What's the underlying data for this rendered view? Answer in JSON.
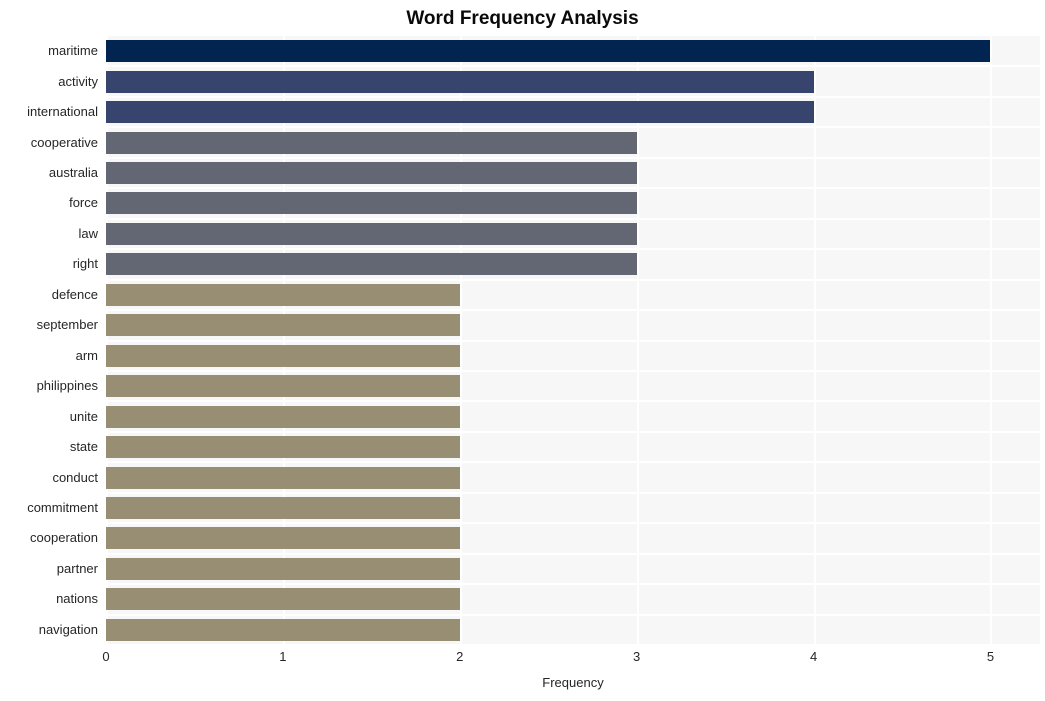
{
  "chart_data": {
    "type": "bar",
    "orientation": "horizontal",
    "title": "Word Frequency Analysis",
    "xlabel": "Frequency",
    "ylabel": "",
    "xlim": [
      0,
      5.28
    ],
    "xticks": [
      0,
      1,
      2,
      3,
      4,
      5
    ],
    "xtick_labels": [
      "0",
      "1",
      "2",
      "3",
      "4",
      "5"
    ],
    "grid": true,
    "grid_color": "#ffffff",
    "plot_background": "#f7f7f7",
    "legend": null,
    "categories": [
      "maritime",
      "activity",
      "international",
      "cooperative",
      "australia",
      "force",
      "law",
      "right",
      "defence",
      "september",
      "arm",
      "philippines",
      "unite",
      "state",
      "conduct",
      "commitment",
      "cooperation",
      "partner",
      "nations",
      "navigation"
    ],
    "values": [
      5,
      4,
      4,
      3,
      3,
      3,
      3,
      3,
      2,
      2,
      2,
      2,
      2,
      2,
      2,
      2,
      2,
      2,
      2,
      2
    ],
    "bar_colors": [
      "#012450",
      "#36446e",
      "#36446e",
      "#636773",
      "#636773",
      "#636773",
      "#636773",
      "#636773",
      "#978e74",
      "#978e74",
      "#978e74",
      "#978e74",
      "#978e74",
      "#978e74",
      "#978e74",
      "#978e74",
      "#978e74",
      "#978e74",
      "#978e74",
      "#978e74"
    ]
  },
  "colors": {
    "title_text": "#0a0a0a",
    "axis_text": "#262626",
    "navy": "#012450",
    "indigo": "#36446e",
    "slate": "#636773",
    "khaki": "#978e74",
    "plot_bg": "#f7f7f7",
    "grid": "#ffffff",
    "page_bg": "#ffffff"
  }
}
